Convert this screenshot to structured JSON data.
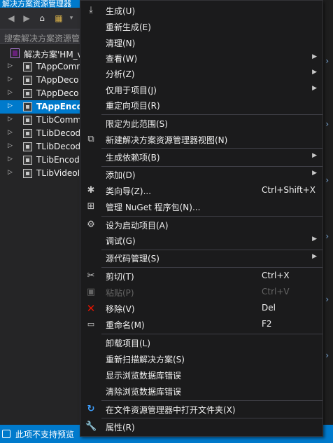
{
  "solution_explorer": {
    "title": "解决方案资源管理器",
    "search_placeholder": "搜索解决方案资源管",
    "solution_label": "解决方案'HM_v",
    "projects": [
      {
        "label": "TAppComm",
        "selected": false
      },
      {
        "label": "TAppDeco",
        "selected": false
      },
      {
        "label": "TAppDeco",
        "selected": false
      },
      {
        "label": "TAppEnco",
        "selected": true
      },
      {
        "label": "TLibComm",
        "selected": false
      },
      {
        "label": "TLibDecod",
        "selected": false
      },
      {
        "label": "TLibDecod",
        "selected": false
      },
      {
        "label": "TLibEncod",
        "selected": false
      },
      {
        "label": "TLibVideoI",
        "selected": false
      }
    ]
  },
  "status_bar": {
    "text": "此项不支持预览"
  },
  "colors": {
    "accent": "#007acc",
    "menu_bg": "#1b1b1c",
    "remove_red": "#e51400",
    "open_blue": "#3ea0ff"
  },
  "context_menu": {
    "items": {
      "build": {
        "label": "生成(U)",
        "icon": "build-icon"
      },
      "rebuild": {
        "label": "重新生成(E)"
      },
      "clean": {
        "label": "清理(N)"
      },
      "view": {
        "label": "查看(W)"
      },
      "analyze": {
        "label": "分析(Z)"
      },
      "project_only": {
        "label": "仅用于项目(J)"
      },
      "retarget": {
        "label": "重定向项目(R)"
      },
      "scope_to_this": {
        "label": "限定为此范围(S)"
      },
      "new_view": {
        "label": "新建解决方案资源管理器视图(N)",
        "icon": "new-view-icon"
      },
      "build_dependencies": {
        "label": "生成依赖项(B)"
      },
      "add": {
        "label": "添加(D)"
      },
      "class_wizard": {
        "label": "类向导(Z)...",
        "shortcut": "Ctrl+Shift+X",
        "icon": "wizard-icon"
      },
      "manage_nuget": {
        "label": "管理 NuGet 程序包(N)...",
        "icon": "nuget-icon"
      },
      "set_startup": {
        "label": "设为启动项目(A)",
        "icon": "gear-icon"
      },
      "debug": {
        "label": "调试(G)"
      },
      "source_control": {
        "label": "源代码管理(S)"
      },
      "cut": {
        "label": "剪切(T)",
        "shortcut": "Ctrl+X",
        "icon": "scissors-icon"
      },
      "paste": {
        "label": "粘贴(P)",
        "shortcut": "Ctrl+V",
        "icon": "paste-icon"
      },
      "remove": {
        "label": "移除(V)",
        "shortcut": "Del",
        "icon": "remove-icon"
      },
      "rename": {
        "label": "重命名(M)",
        "shortcut": "F2",
        "icon": "rename-icon"
      },
      "unload": {
        "label": "卸载项目(L)"
      },
      "rescan": {
        "label": "重新扫描解决方案(S)"
      },
      "show_db_errors": {
        "label": "显示浏览数据库错误"
      },
      "clear_db_errors": {
        "label": "清除浏览数据库错误"
      },
      "open_in_explorer": {
        "label": "在文件资源管理器中打开文件夹(X)",
        "icon": "refresh-arrow-icon"
      },
      "properties": {
        "label": "属性(R)",
        "icon": "wrench-icon"
      }
    }
  }
}
